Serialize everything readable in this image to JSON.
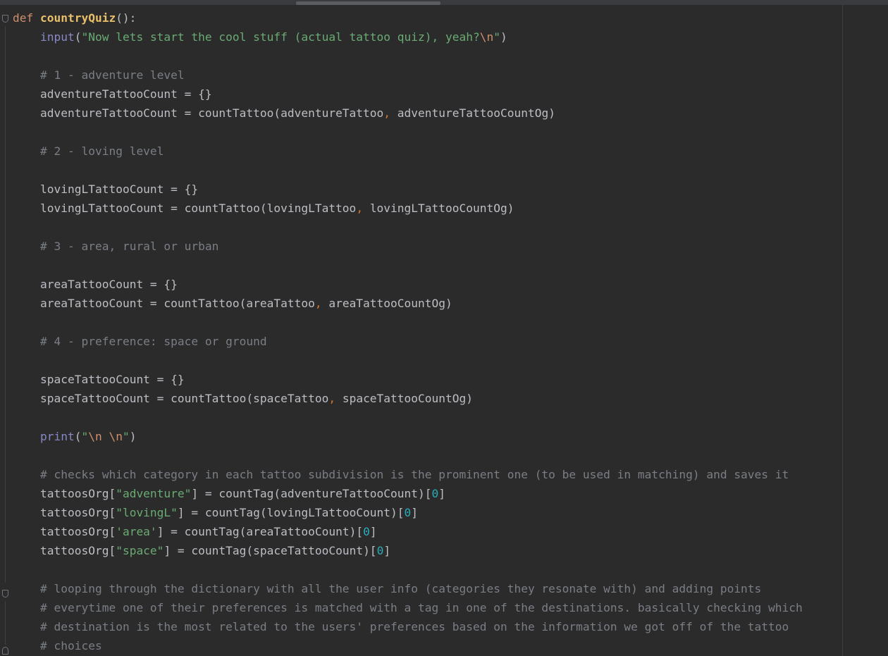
{
  "editor": {
    "lines": [
      {
        "id": "l1",
        "tokens": [
          [
            "kw",
            "def "
          ],
          [
            "defname",
            "countryQuiz"
          ],
          [
            "punc",
            "():"
          ]
        ]
      },
      {
        "id": "l2",
        "tokens": [
          [
            "builtin",
            "input"
          ],
          [
            "punc",
            "("
          ],
          [
            "str",
            "\"Now lets start the cool stuff (actual tattoo quiz), yeah?"
          ],
          [
            "esc",
            "\\n"
          ],
          [
            "str",
            "\""
          ],
          [
            "punc",
            ")"
          ]
        ]
      },
      {
        "id": "l3",
        "tokens": []
      },
      {
        "id": "l4",
        "tokens": [
          [
            "cmt",
            "# 1 - adventure level"
          ]
        ]
      },
      {
        "id": "l5",
        "tokens": [
          [
            "punc",
            "adventureTattooCount = {}"
          ]
        ]
      },
      {
        "id": "l6",
        "tokens": [
          [
            "punc",
            "adventureTattooCount = countTattoo(adventureTattoo"
          ],
          [
            "comma",
            ", "
          ],
          [
            "punc",
            "adventureTattooCountOg)"
          ]
        ]
      },
      {
        "id": "l7",
        "tokens": []
      },
      {
        "id": "l8",
        "tokens": [
          [
            "cmt",
            "# 2 - loving level"
          ]
        ]
      },
      {
        "id": "l9",
        "tokens": []
      },
      {
        "id": "l10",
        "tokens": [
          [
            "punc",
            "lovingLTattooCount = {}"
          ]
        ]
      },
      {
        "id": "l11",
        "tokens": [
          [
            "punc",
            "lovingLTattooCount = countTattoo(lovingLTattoo"
          ],
          [
            "comma",
            ", "
          ],
          [
            "punc",
            "lovingLTattooCountOg)"
          ]
        ]
      },
      {
        "id": "l12",
        "tokens": []
      },
      {
        "id": "l13",
        "tokens": [
          [
            "cmt",
            "# 3 - area, rural or urban"
          ]
        ]
      },
      {
        "id": "l14",
        "tokens": []
      },
      {
        "id": "l15",
        "tokens": [
          [
            "punc",
            "areaTattooCount = {}"
          ]
        ]
      },
      {
        "id": "l16",
        "tokens": [
          [
            "punc",
            "areaTattooCount = countTattoo(areaTattoo"
          ],
          [
            "comma",
            ", "
          ],
          [
            "punc",
            "areaTattooCountOg)"
          ]
        ]
      },
      {
        "id": "l17",
        "tokens": []
      },
      {
        "id": "l18",
        "tokens": [
          [
            "cmt",
            "# 4 - preference: space or ground"
          ]
        ]
      },
      {
        "id": "l19",
        "tokens": []
      },
      {
        "id": "l20",
        "tokens": [
          [
            "punc",
            "spaceTattooCount = {}"
          ]
        ]
      },
      {
        "id": "l21",
        "tokens": [
          [
            "punc",
            "spaceTattooCount = countTattoo(spaceTattoo"
          ],
          [
            "comma",
            ", "
          ],
          [
            "punc",
            "spaceTattooCountOg)"
          ]
        ]
      },
      {
        "id": "l22",
        "tokens": []
      },
      {
        "id": "l23",
        "tokens": [
          [
            "builtin",
            "print"
          ],
          [
            "punc",
            "("
          ],
          [
            "str",
            "\""
          ],
          [
            "esc",
            "\\n"
          ],
          [
            "str",
            " "
          ],
          [
            "esc",
            "\\n"
          ],
          [
            "str",
            "\""
          ],
          [
            "punc",
            ")"
          ]
        ]
      },
      {
        "id": "l24",
        "tokens": []
      },
      {
        "id": "l25",
        "tokens": [
          [
            "cmt",
            "# checks which category in each tattoo subdivision is the prominent one (to be used in matching) and saves it"
          ]
        ]
      },
      {
        "id": "l26",
        "tokens": [
          [
            "punc",
            "tattoosOrg["
          ],
          [
            "str",
            "\"adventure\""
          ],
          [
            "punc",
            "] = countTag(adventureTattooCount)["
          ],
          [
            "num",
            "0"
          ],
          [
            "punc",
            "]"
          ]
        ]
      },
      {
        "id": "l27",
        "tokens": [
          [
            "punc",
            "tattoosOrg["
          ],
          [
            "str",
            "\"lovingL\""
          ],
          [
            "punc",
            "] = countTag(lovingLTattooCount)["
          ],
          [
            "num",
            "0"
          ],
          [
            "punc",
            "]"
          ]
        ]
      },
      {
        "id": "l28",
        "tokens": [
          [
            "punc",
            "tattoosOrg["
          ],
          [
            "str",
            "'area'"
          ],
          [
            "punc",
            "] = countTag(areaTattooCount)["
          ],
          [
            "num",
            "0"
          ],
          [
            "punc",
            "]"
          ]
        ]
      },
      {
        "id": "l29",
        "tokens": [
          [
            "punc",
            "tattoosOrg["
          ],
          [
            "str",
            "\"space\""
          ],
          [
            "punc",
            "] = countTag(spaceTattooCount)["
          ],
          [
            "num",
            "0"
          ],
          [
            "punc",
            "]"
          ]
        ]
      },
      {
        "id": "l30",
        "tokens": []
      },
      {
        "id": "l31",
        "tokens": [
          [
            "cmt",
            "# looping through the dictionary with all the user info (categories they resonate with) and adding points"
          ]
        ]
      },
      {
        "id": "l32",
        "tokens": [
          [
            "cmt",
            "# everytime one of their preferences is matched with a tag in one of the destinations. basically checking which"
          ]
        ]
      },
      {
        "id": "l33",
        "tokens": [
          [
            "cmt",
            "# destination is the most related to the users' preferences based on the information we got off of the tattoo"
          ]
        ]
      },
      {
        "id": "l34",
        "tokens": [
          [
            "cmt",
            "# choices"
          ]
        ]
      }
    ]
  },
  "colors": {
    "background": "#2b2b2b",
    "keyword": "#cf8e6d",
    "function_name": "#e8bf6a",
    "builtin": "#8888c6",
    "string": "#6aab73",
    "number": "#2aacb8",
    "comment": "#7a7e85",
    "text": "#bcbec4"
  }
}
